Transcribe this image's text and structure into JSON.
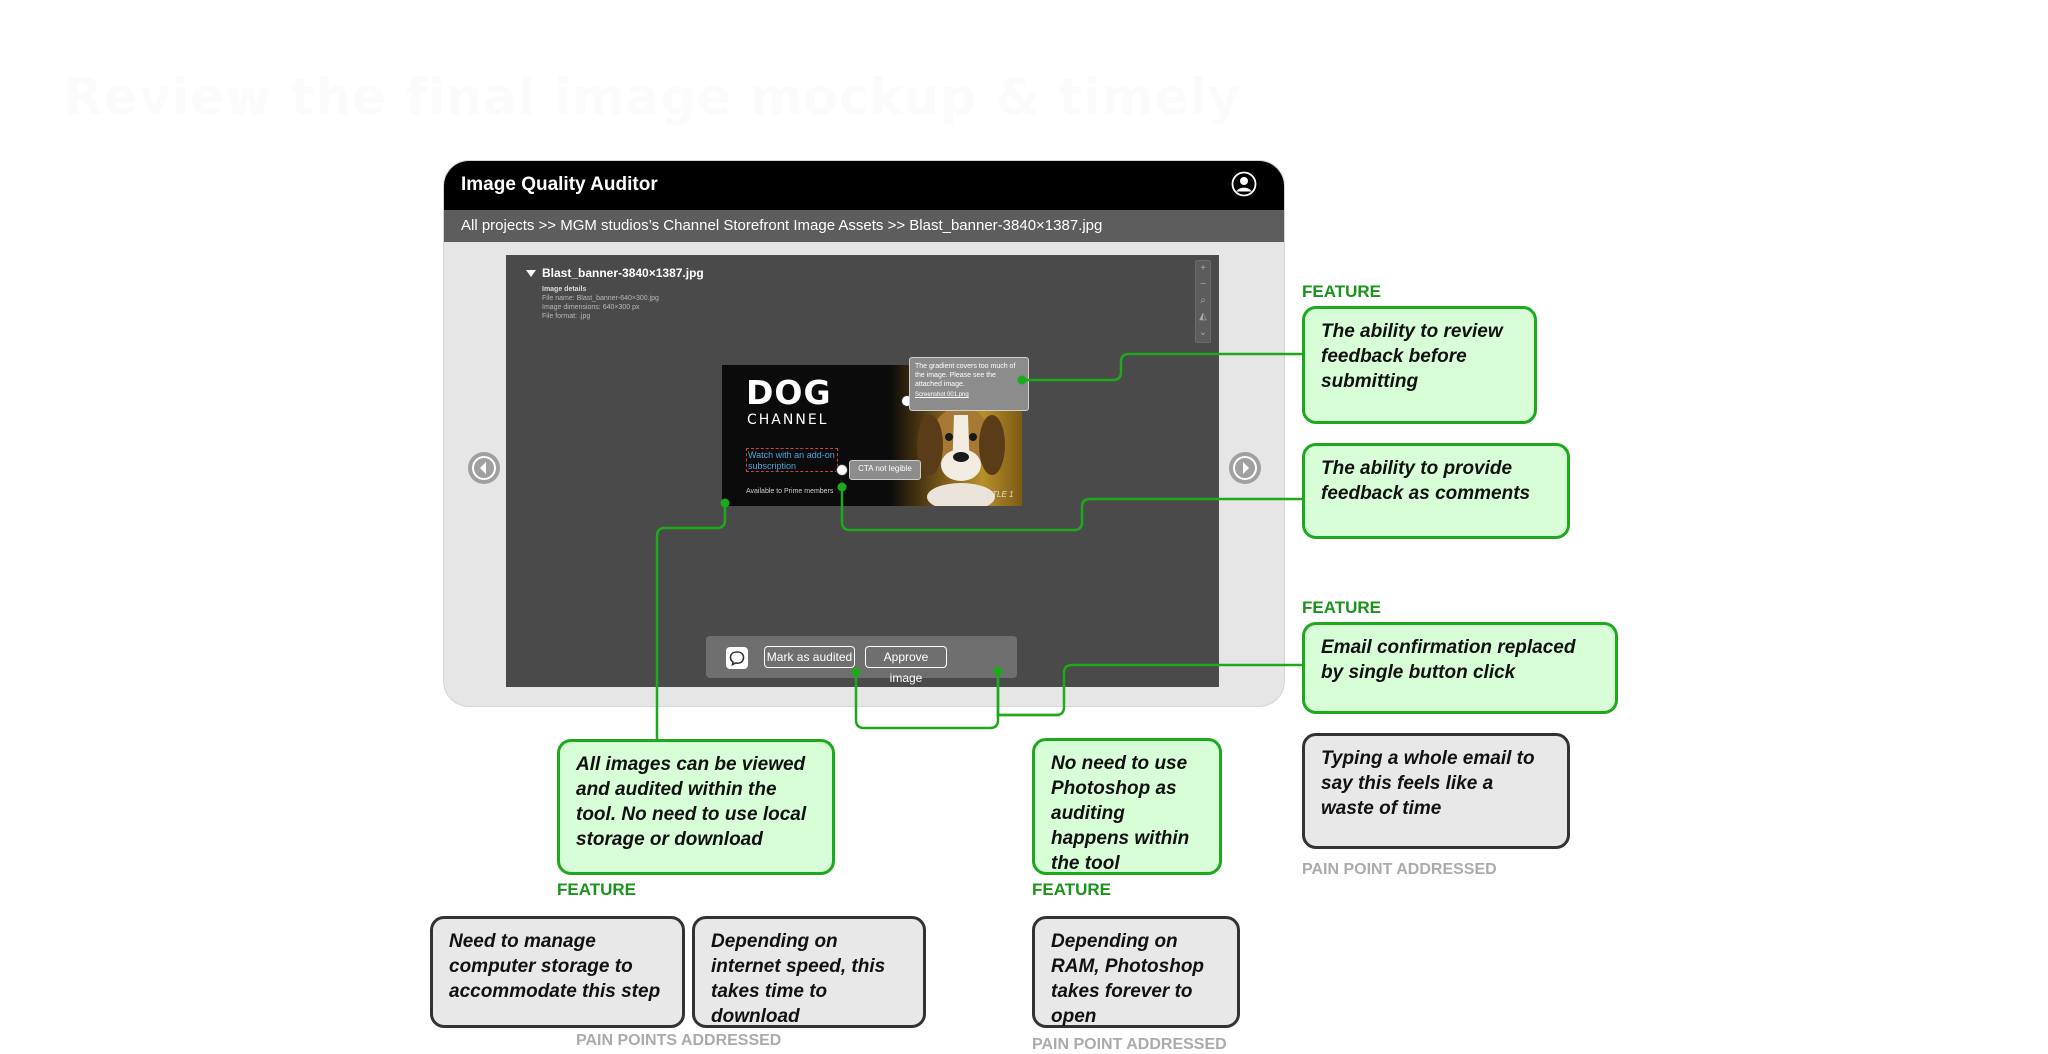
{
  "heading": "Review the final image mockup & timely",
  "app": {
    "title": "Image Quality Auditor",
    "breadcrumb": "All projects >> MGM studios’s Channel Storefront Image Assets >> Blast_banner-3840×1387.jpg",
    "user_icon": "user-circle-icon"
  },
  "viewer": {
    "file_name": "Blast_banner-3840×1387.jpg",
    "details": {
      "heading": "Image details",
      "file_name": "File name: Blast_banner-640×300.jpg",
      "dimensions": "Image dimensions: 640×300 px",
      "format": "File format: .jpg"
    },
    "zoom_icons": [
      "zoom-in-icon",
      "zoom-out-icon",
      "magnify-icon",
      "adjust-icon",
      "expand-icon"
    ],
    "banner": {
      "headline": "DOG",
      "subhead": "CHANNEL",
      "cta": "Watch with an add-on subscription",
      "availability": "Available to Prime members",
      "title_tag": "TITLE 1"
    },
    "comments": [
      {
        "text": "The gradient covers too much of the image. Please see the attached image.",
        "attachment": "Screenshot 001.png"
      },
      {
        "text": "CTA not legible"
      }
    ],
    "actions": {
      "comment_icon": "comment-icon",
      "mark_audited": "Mark as audited",
      "approve": "Approve image"
    }
  },
  "labels": {
    "feature": "FEATURE",
    "pain_point_addressed": "PAIN POINT ADDRESSED",
    "pain_points_addressed": "PAIN POINTS ADDRESSED"
  },
  "features": {
    "review_feedback": "The ability to review feedback before submitting",
    "comments": "The ability to provide feedback as comments",
    "email_replaced": "Email confirmation replaced by single button click",
    "view_in_tool": "All images can be viewed and audited within the tool. No need to use local storage or download",
    "no_photoshop": "No need to use Photoshop as auditing happens within the tool"
  },
  "pain_points": {
    "email": "Typing a whole email to say this feels like a waste of time",
    "storage": "Need to manage computer storage to accommodate this step",
    "internet": "Depending on internet speed, this takes time to download",
    "ram": "Depending on RAM, Photoshop takes forever to open"
  },
  "colors": {
    "feature_border": "#1ca91c",
    "feature_fill": "#d7fed7",
    "feature_label": "#1a931a",
    "pain_border": "#333333",
    "pain_fill": "#e8e8e8",
    "pain_label": "#ababab"
  }
}
